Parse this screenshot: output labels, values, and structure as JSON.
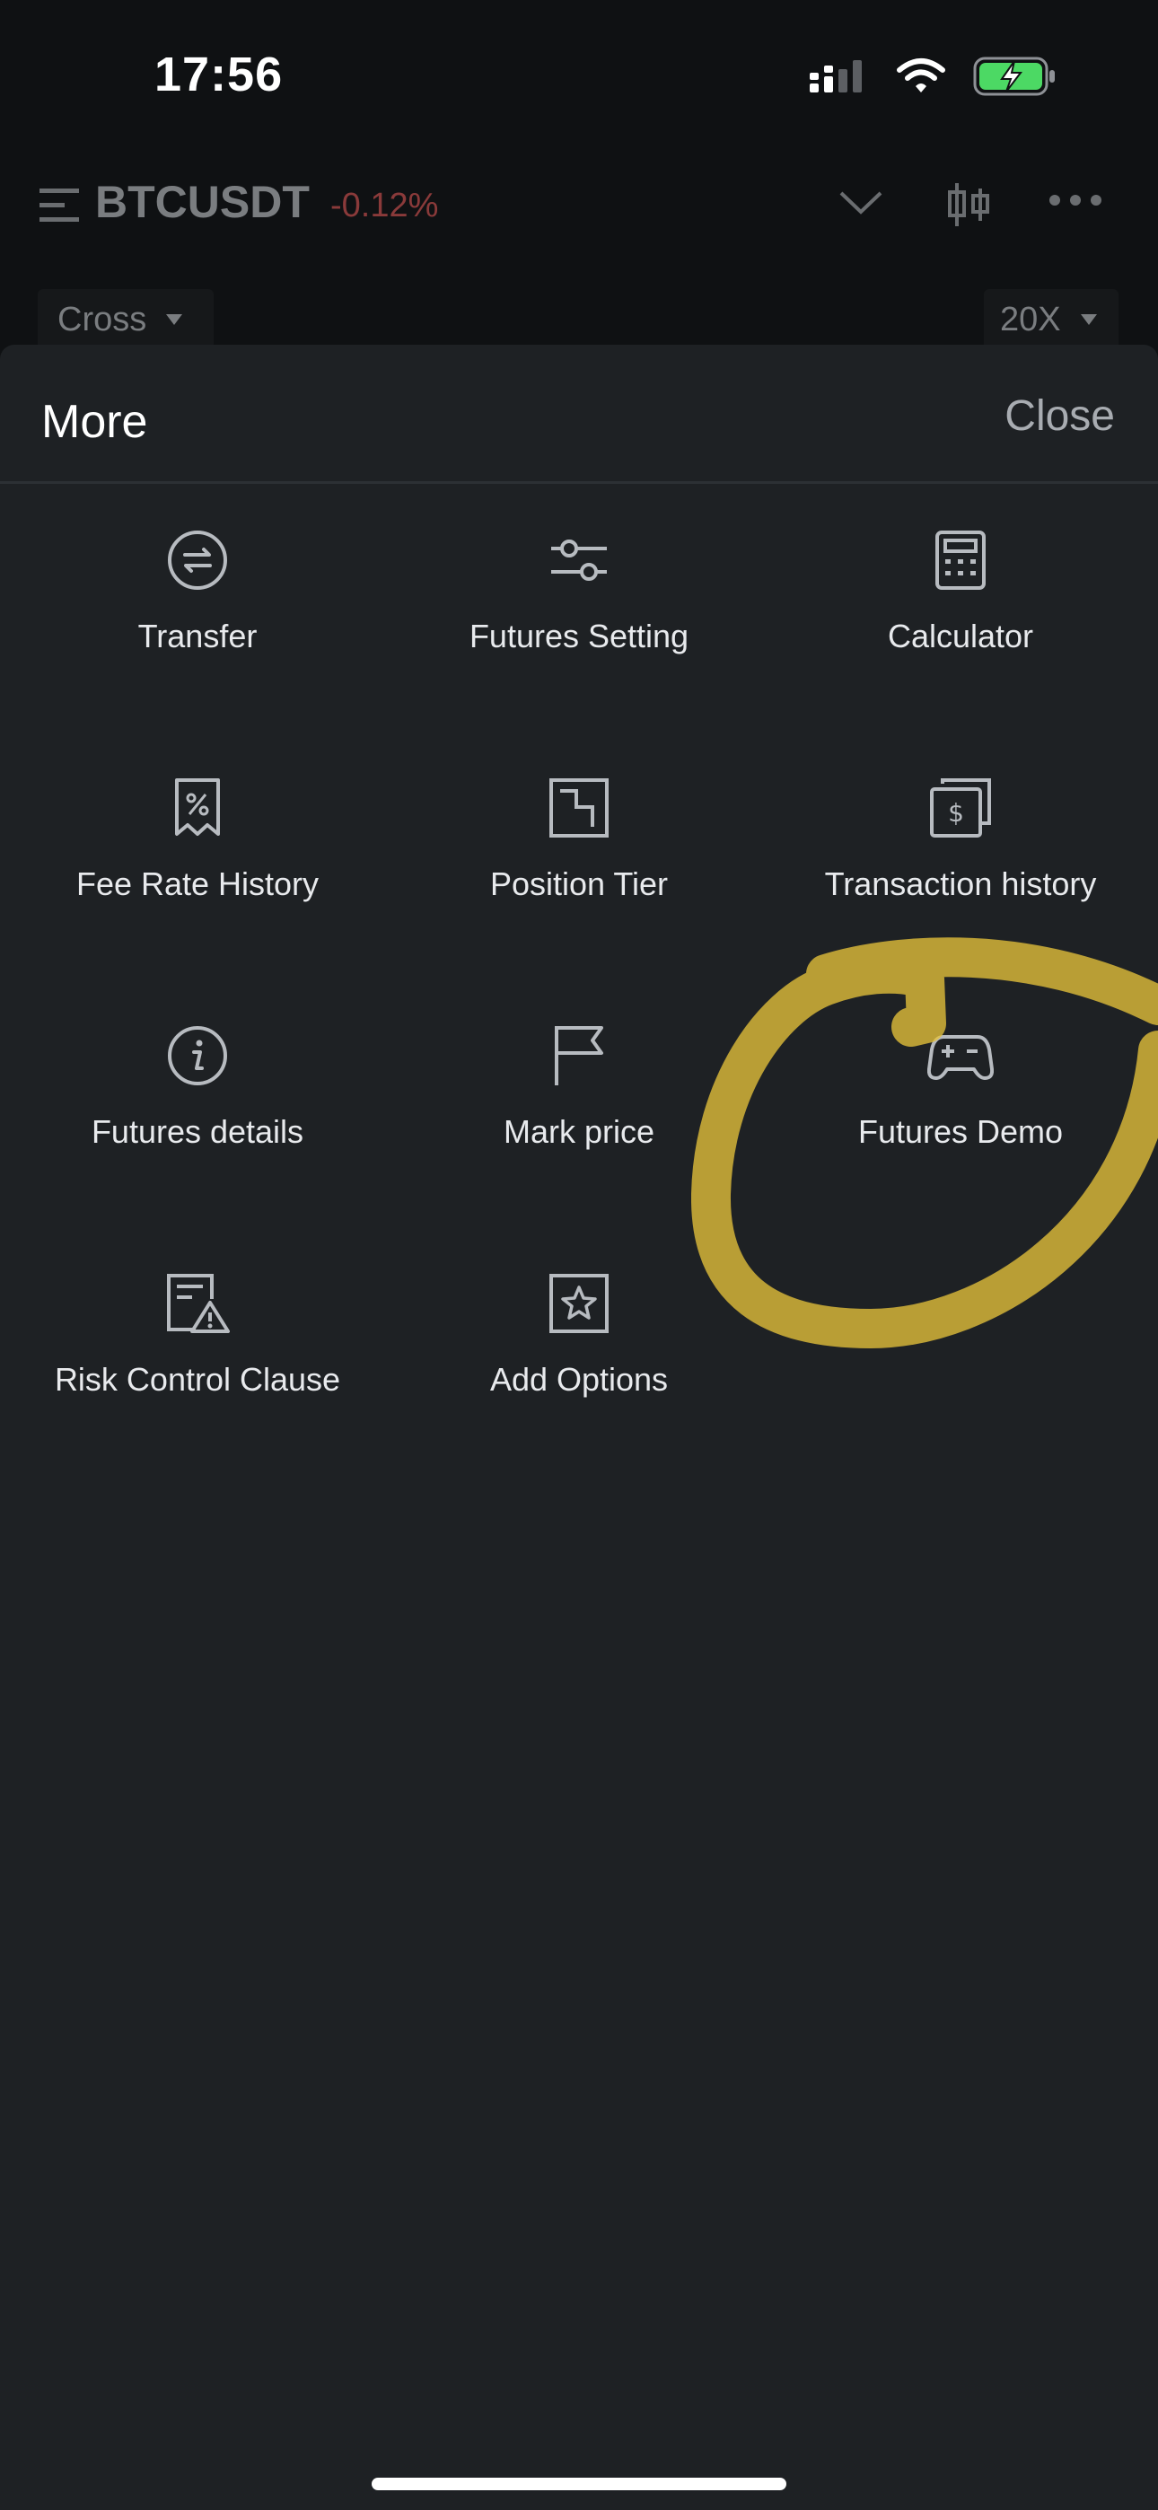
{
  "status_bar": {
    "time": "17:56",
    "icons": [
      "signal-icon",
      "wifi-icon",
      "battery-charging-icon"
    ]
  },
  "background": {
    "pair": "BTCUSDT",
    "change": "-0.12%",
    "margin_mode": "Cross",
    "leverage": "20X"
  },
  "sheet": {
    "title": "More",
    "close_label": "Close",
    "items": [
      {
        "label": "Transfer",
        "icon": "transfer-icon"
      },
      {
        "label": "Futures Setting",
        "icon": "sliders-icon"
      },
      {
        "label": "Calculator",
        "icon": "calculator-icon"
      },
      {
        "label": "Fee Rate History",
        "icon": "receipt-percent-icon"
      },
      {
        "label": "Position Tier",
        "icon": "tier-steps-icon"
      },
      {
        "label": "Transaction history",
        "icon": "dollar-cards-icon"
      },
      {
        "label": "Futures details",
        "icon": "info-icon"
      },
      {
        "label": "Mark price",
        "icon": "flag-icon"
      },
      {
        "label": "Futures Demo",
        "icon": "gamepad-icon"
      },
      {
        "label": "Risk Control Clause",
        "icon": "document-warning-icon"
      },
      {
        "label": "Add Options",
        "icon": "star-square-icon"
      }
    ]
  },
  "colors": {
    "sheet_background": "#1e2124",
    "highlight": "#e6c23a",
    "negative_change": "#8a3a3a"
  }
}
